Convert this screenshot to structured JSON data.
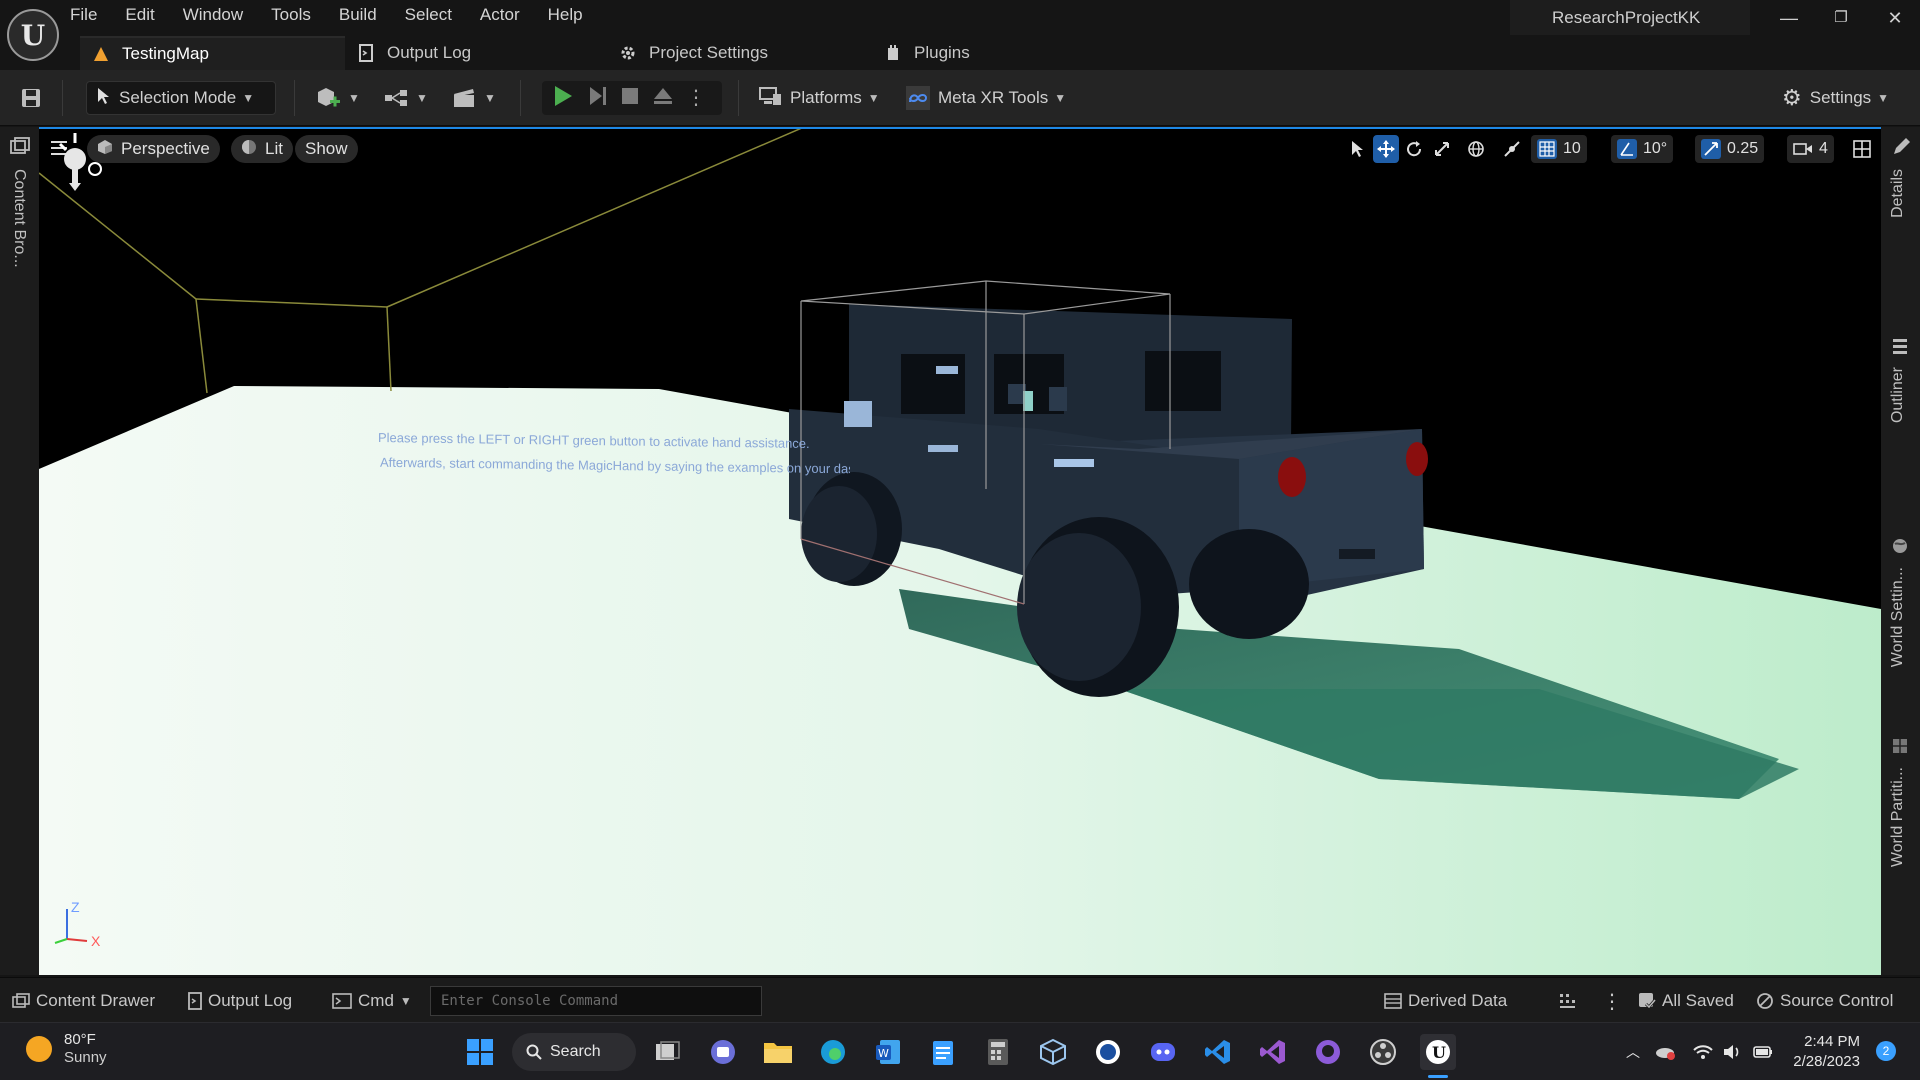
{
  "app": {
    "project_name": "ResearchProjectKK",
    "menu": [
      "File",
      "Edit",
      "Window",
      "Tools",
      "Build",
      "Select",
      "Actor",
      "Help"
    ],
    "tabs": [
      {
        "label": "TestingMap",
        "icon": "level-icon"
      },
      {
        "label": "Output Log",
        "icon": "output-log-icon"
      },
      {
        "label": "Project Settings",
        "icon": "settings-gear-icon"
      },
      {
        "label": "Plugins",
        "icon": "plugin-icon"
      }
    ]
  },
  "toolbar": {
    "selection_mode": "Selection Mode",
    "platforms": "Platforms",
    "meta_xr_tools": "Meta XR Tools",
    "settings": "Settings"
  },
  "side_panels": {
    "left": [
      "Content Bro..."
    ],
    "right": [
      "Details",
      "Outliner",
      "World Settin...",
      "World Partiti..."
    ]
  },
  "viewport": {
    "perspective": "Perspective",
    "lit": "Lit",
    "show": "Show",
    "grid_snap": "10",
    "rotation_snap": "10°",
    "scale_snap": "0.25",
    "camera_speed": "4",
    "hud_line1": "Please press the LEFT or RIGHT green button to activate hand assistance.",
    "hud_line2": "Afterwards, start commanding the MagicHand by saying the examples on your dashboard",
    "axis_labels": {
      "z": "Z",
      "x": "X"
    }
  },
  "statusbar": {
    "content_drawer": "Content Drawer",
    "output_log": "Output Log",
    "cmd": "Cmd",
    "console_placeholder": "Enter Console Command",
    "derived_data": "Derived Data",
    "all_saved": "All Saved",
    "source_control": "Source Control"
  },
  "taskbar": {
    "weather_temp": "80°F",
    "weather_desc": "Sunny",
    "search": "Search",
    "time": "2:44 PM",
    "date": "2/28/2023",
    "notification_count": "2"
  },
  "colors": {
    "accent_blue": "#1f5ea8",
    "play_green": "#4caf50",
    "floor": "#dff4e6",
    "car_body": "#253140"
  }
}
